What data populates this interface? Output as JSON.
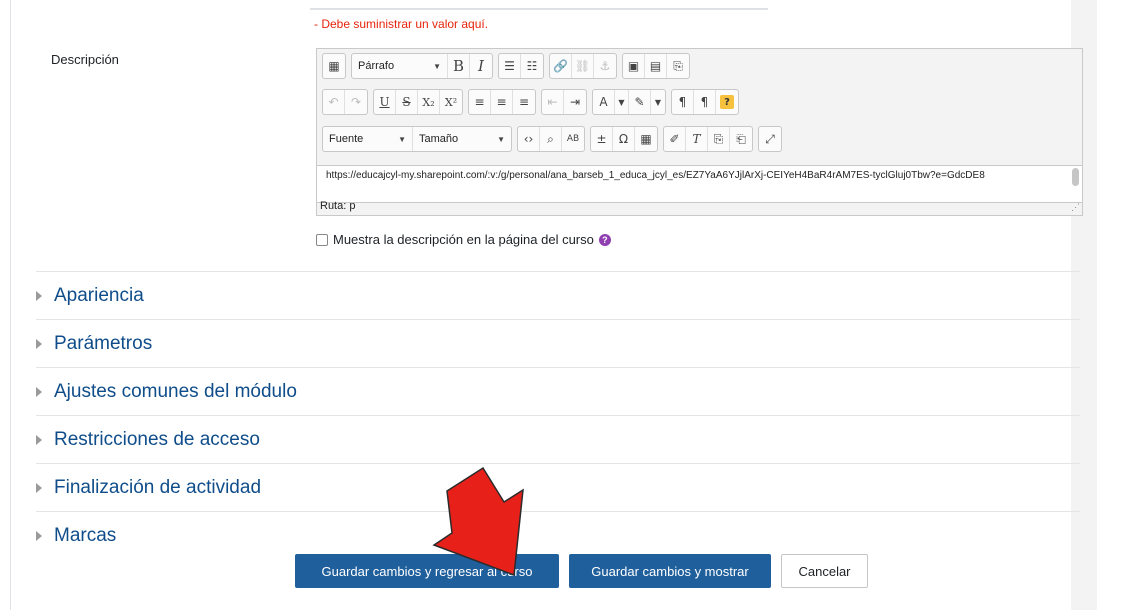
{
  "form": {
    "error_message": "- Debe suministrar un valor aquí.",
    "description_label": "Descripción",
    "editor": {
      "paragraph_select": "Párrafo",
      "font_select": "Fuente",
      "size_select": "Tamaño",
      "content": "https://educajcyl-my.sharepoint.com/:v:/g/personal/ana_barseb_1_educa_jcyl_es/EZ7YaA6YJjlArXj-CEIYeH4BaR4rAM7ES-tyclGluj0Tbw?e=GdcDE8",
      "path": "Ruta: p",
      "help_glyph": "?"
    },
    "show_description_label": "Muestra la descripción en la página del curso",
    "help_icon_glyph": "?"
  },
  "sections": [
    {
      "title": "Apariencia"
    },
    {
      "title": "Parámetros"
    },
    {
      "title": "Ajustes comunes del módulo"
    },
    {
      "title": "Restricciones de acceso"
    },
    {
      "title": "Finalización de actividad"
    },
    {
      "title": "Marcas"
    }
  ],
  "buttons": {
    "save_return": "Guardar cambios y regresar al curso",
    "save_display": "Guardar cambios y mostrar",
    "cancel": "Cancelar"
  },
  "colors": {
    "primary": "#1f5f9c",
    "link": "#0f4d8a",
    "error": "#e5240c",
    "arrow": "#e8201a"
  }
}
